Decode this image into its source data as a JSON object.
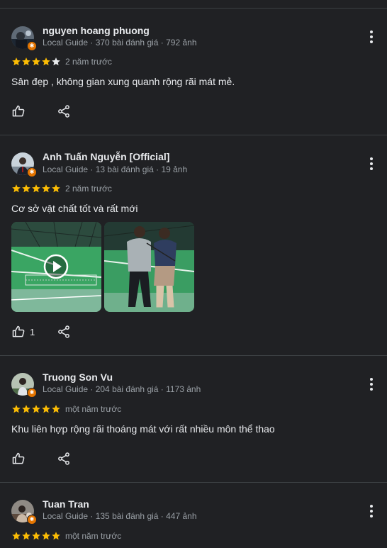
{
  "reviews": [
    {
      "name": "nguyen hoang phuong",
      "meta": "Local Guide · 370 bài đánh giá · 792 ảnh",
      "rating": 4,
      "time": "2 năm trước",
      "text": "Sân đẹp , không gian xung quanh rộng rãi mát mẻ.",
      "likes": ""
    },
    {
      "name": "Anh Tuấn Nguyễn [Official]",
      "meta": "Local Guide · 13 bài đánh giá · 19 ảnh",
      "rating": 5,
      "time": "2 năm trước",
      "text": "Cơ sở vật chất tốt và rất mới",
      "likes": "1"
    },
    {
      "name": "Truong Son Vu",
      "meta": "Local Guide · 204 bài đánh giá · 1173 ảnh",
      "rating": 5,
      "time": "một năm trước",
      "text": "Khu liên hợp rộng rãi thoáng mát với rất nhiều môn thể thao",
      "likes": ""
    },
    {
      "name": "Tuan Tran",
      "meta": "Local Guide · 135 bài đánh giá · 447 ảnh",
      "rating": 5,
      "time": "một năm trước"
    }
  ],
  "colors": {
    "background": "#202124",
    "divider": "#3c4043",
    "star_filled": "#fbbc04",
    "star_empty": "#e8eaed",
    "badge": "#e37400"
  },
  "icons": [
    "thumb-up-icon",
    "share-icon",
    "more-vert-icon",
    "play-icon",
    "star-icon",
    "local-guide-badge-icon"
  ]
}
